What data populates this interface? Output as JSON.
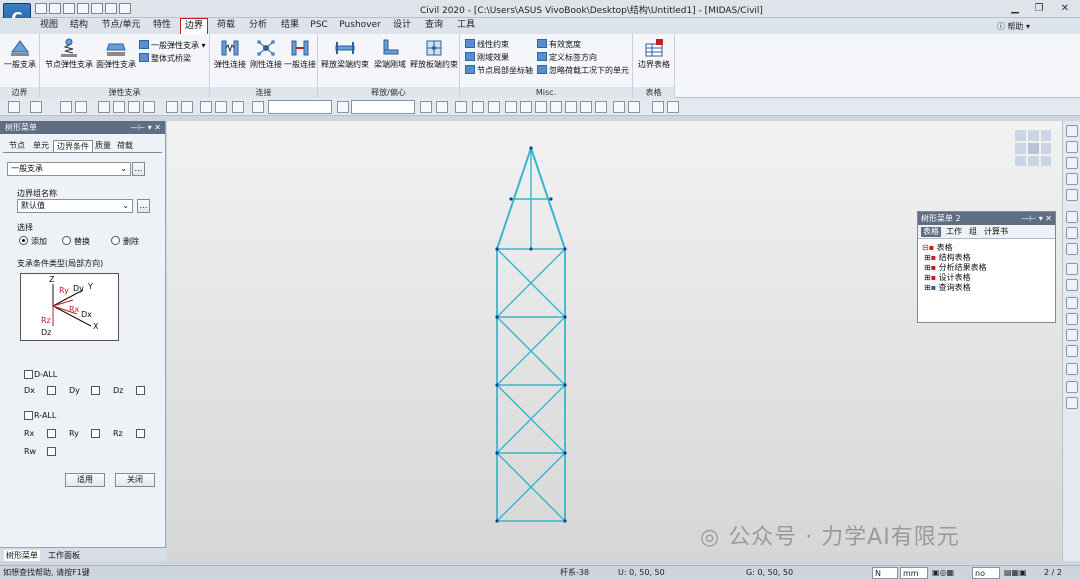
{
  "window": {
    "title": "Civil 2020 - [C:\\Users\\ASUS VivoBook\\Desktop\\结构\\Untitled1] - [MIDAS/Civil]",
    "app_button_label": "C",
    "help_label": "帮助"
  },
  "menu": {
    "tabs": [
      "视图",
      "结构",
      "节点/单元",
      "特性",
      "边界",
      "荷载",
      "分析",
      "结果",
      "PSC",
      "Pushover",
      "设计",
      "查询",
      "工具"
    ],
    "active": "边界"
  },
  "ribbon": {
    "groups": {
      "boundary": "边界",
      "elastic": "弹性支承",
      "link": "连接",
      "release": "释放/偏心",
      "misc": "Misc.",
      "table": "表格"
    },
    "buttons": {
      "general_support": "一般支承",
      "node_elastic": "节点弹性支承",
      "surface_elastic": "面弹性支承",
      "general_elastic": "一般弹性支承",
      "integral_bridge": "整体式桥梁",
      "elastic_link": "弹性连接",
      "rigid_link": "刚性连接",
      "general_link": "一般连接",
      "beam_release": "释放梁端约束",
      "beam_offset": "梁端刚域",
      "plate_release": "释放板端约束",
      "linear_constraint": "线性约束",
      "rigid_effect": "刚域效果",
      "node_local_axis": "节点局部坐标轴",
      "effective_width": "有效宽度",
      "define_label_dir": "定义标签方向",
      "ignore_element": "忽略荷载工况下的单元",
      "boundary_table": "边界表格"
    }
  },
  "left_panel": {
    "title": "树形菜单",
    "tabs": [
      "节点",
      "单元",
      "边界条件",
      "质量",
      "荷载"
    ],
    "active_tab": "边界条件",
    "function_select": "一般支承",
    "group_label": "边界组名称",
    "group_value": "默认值",
    "select_label": "选择",
    "radio_add": "添加",
    "radio_replace": "替换",
    "radio_delete": "删除",
    "support_type_label": "支承条件类型(局部方向)",
    "diagram": {
      "z": "Z",
      "y": "Y",
      "x": "X",
      "dx": "Dx",
      "dy": "Dy",
      "dz": "Dz",
      "rx": "Rx",
      "ry": "Ry",
      "rz": "Rz"
    },
    "d_all": "D-ALL",
    "dx": "Dx",
    "dy": "Dy",
    "dz": "Dz",
    "r_all": "R-ALL",
    "rx": "Rx",
    "ry": "Ry",
    "rz": "Rz",
    "rw": "Rw",
    "apply": "适用",
    "close": "关闭",
    "footer_tabs": [
      "树形菜单",
      "工作面板"
    ]
  },
  "tree_panel_2": {
    "title": "树形菜单 2",
    "tabs": [
      "表格",
      "工作",
      "组",
      "计算书"
    ],
    "active_tab": "表格",
    "root": "表格",
    "items": [
      "结构表格",
      "分析结果表格",
      "设计表格",
      "查询表格"
    ]
  },
  "status": {
    "hint": "如想查找帮助, 请按F1键",
    "element": "杆系-38",
    "ucs": "U: 0, 50, 50",
    "gcs": "G: 0, 50, 50",
    "unit_force": "N",
    "unit_length": "mm",
    "none": "no",
    "page": "2",
    "page_total": "2"
  },
  "watermark": "公众号 · 力学AI有限元",
  "colors": {
    "accent": "#c41e1e",
    "truss": "#37b8c9",
    "node": "#1a3a9e",
    "panel_header": "#5f6e82"
  }
}
